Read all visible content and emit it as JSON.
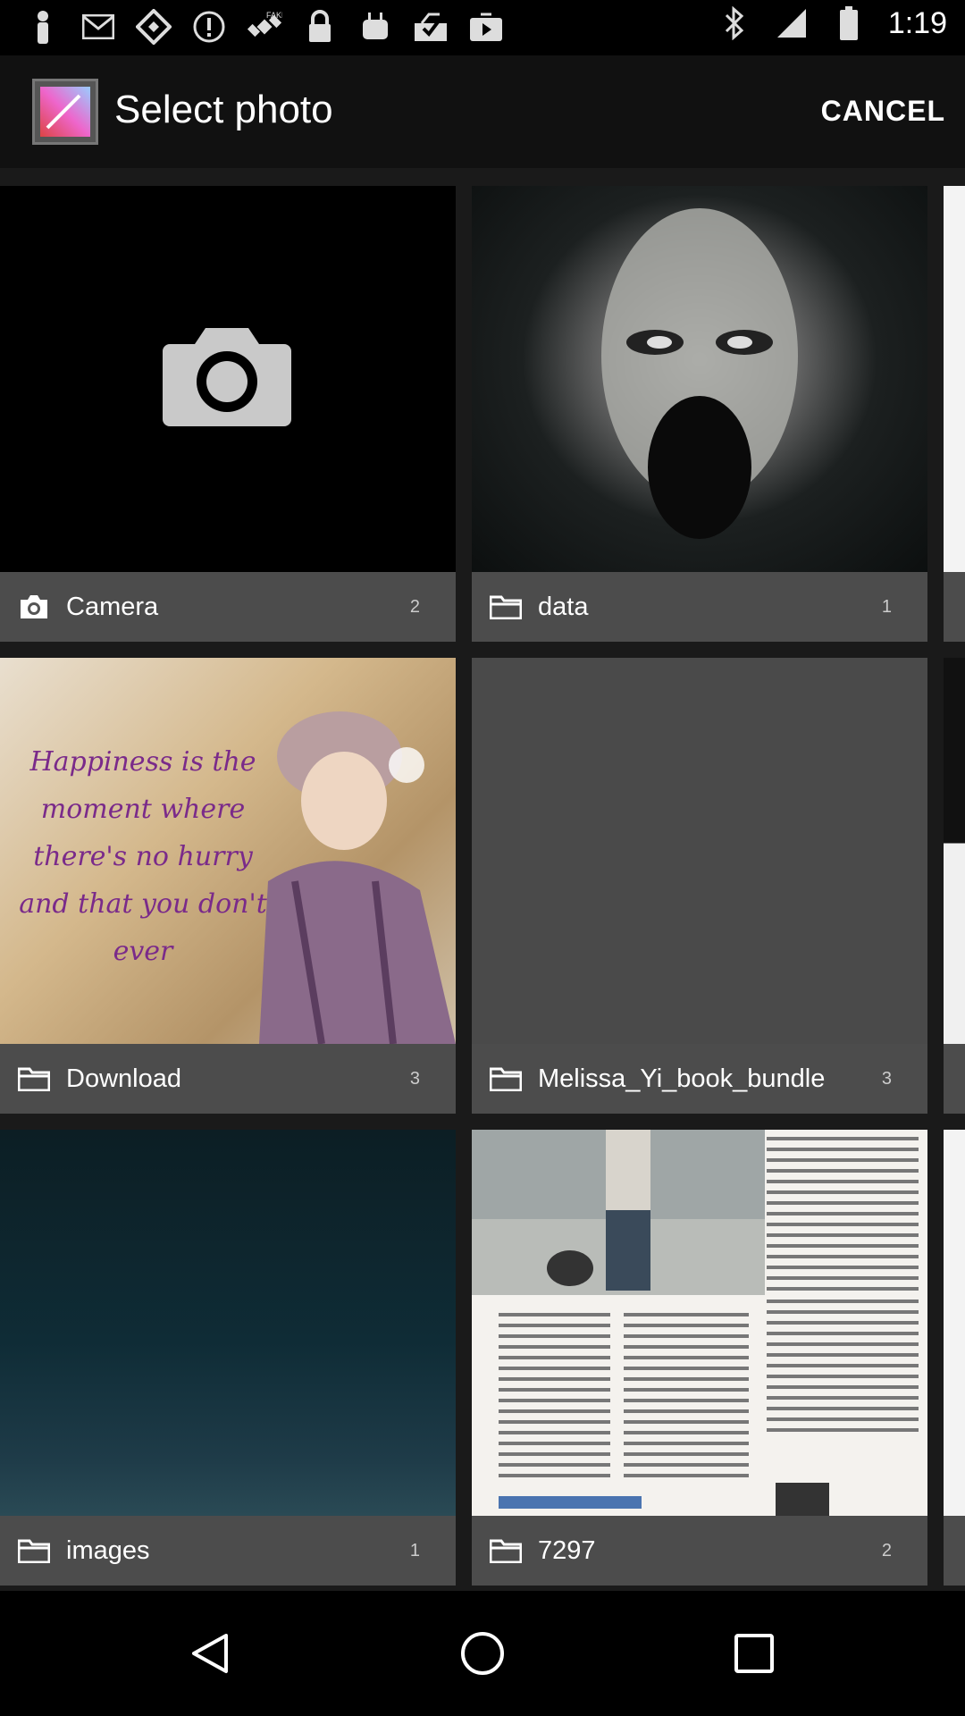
{
  "status_bar": {
    "time": "1:19",
    "left_icons": [
      "person-icon",
      "mail-icon",
      "diamond-icon",
      "alert-icon",
      "fake-gps-icon",
      "lock-icon",
      "android-icon",
      "download-check-icon",
      "play-store-icon"
    ],
    "right_icons": [
      "bluetooth-icon",
      "signal-icon",
      "battery-icon"
    ]
  },
  "action_bar": {
    "title": "Select photo",
    "cancel_label": "CANCEL"
  },
  "albums": [
    {
      "label": "Camera",
      "count": "2",
      "icon": "camera-icon"
    },
    {
      "label": "data",
      "count": "1",
      "icon": "folder-icon"
    },
    {
      "label": "Download",
      "count": "3",
      "icon": "folder-icon"
    },
    {
      "label": "Melissa_Yi_book_bundle",
      "count": "3",
      "icon": "folder-icon"
    },
    {
      "label": "images",
      "count": "1",
      "icon": "folder-icon"
    },
    {
      "label": "7297",
      "count": "2",
      "icon": "folder-icon"
    }
  ],
  "download_thumb_text": "Happiness is the moment where there's no hurry and that you don't ever",
  "nav_bar": [
    "back-icon",
    "home-icon",
    "recents-icon"
  ]
}
